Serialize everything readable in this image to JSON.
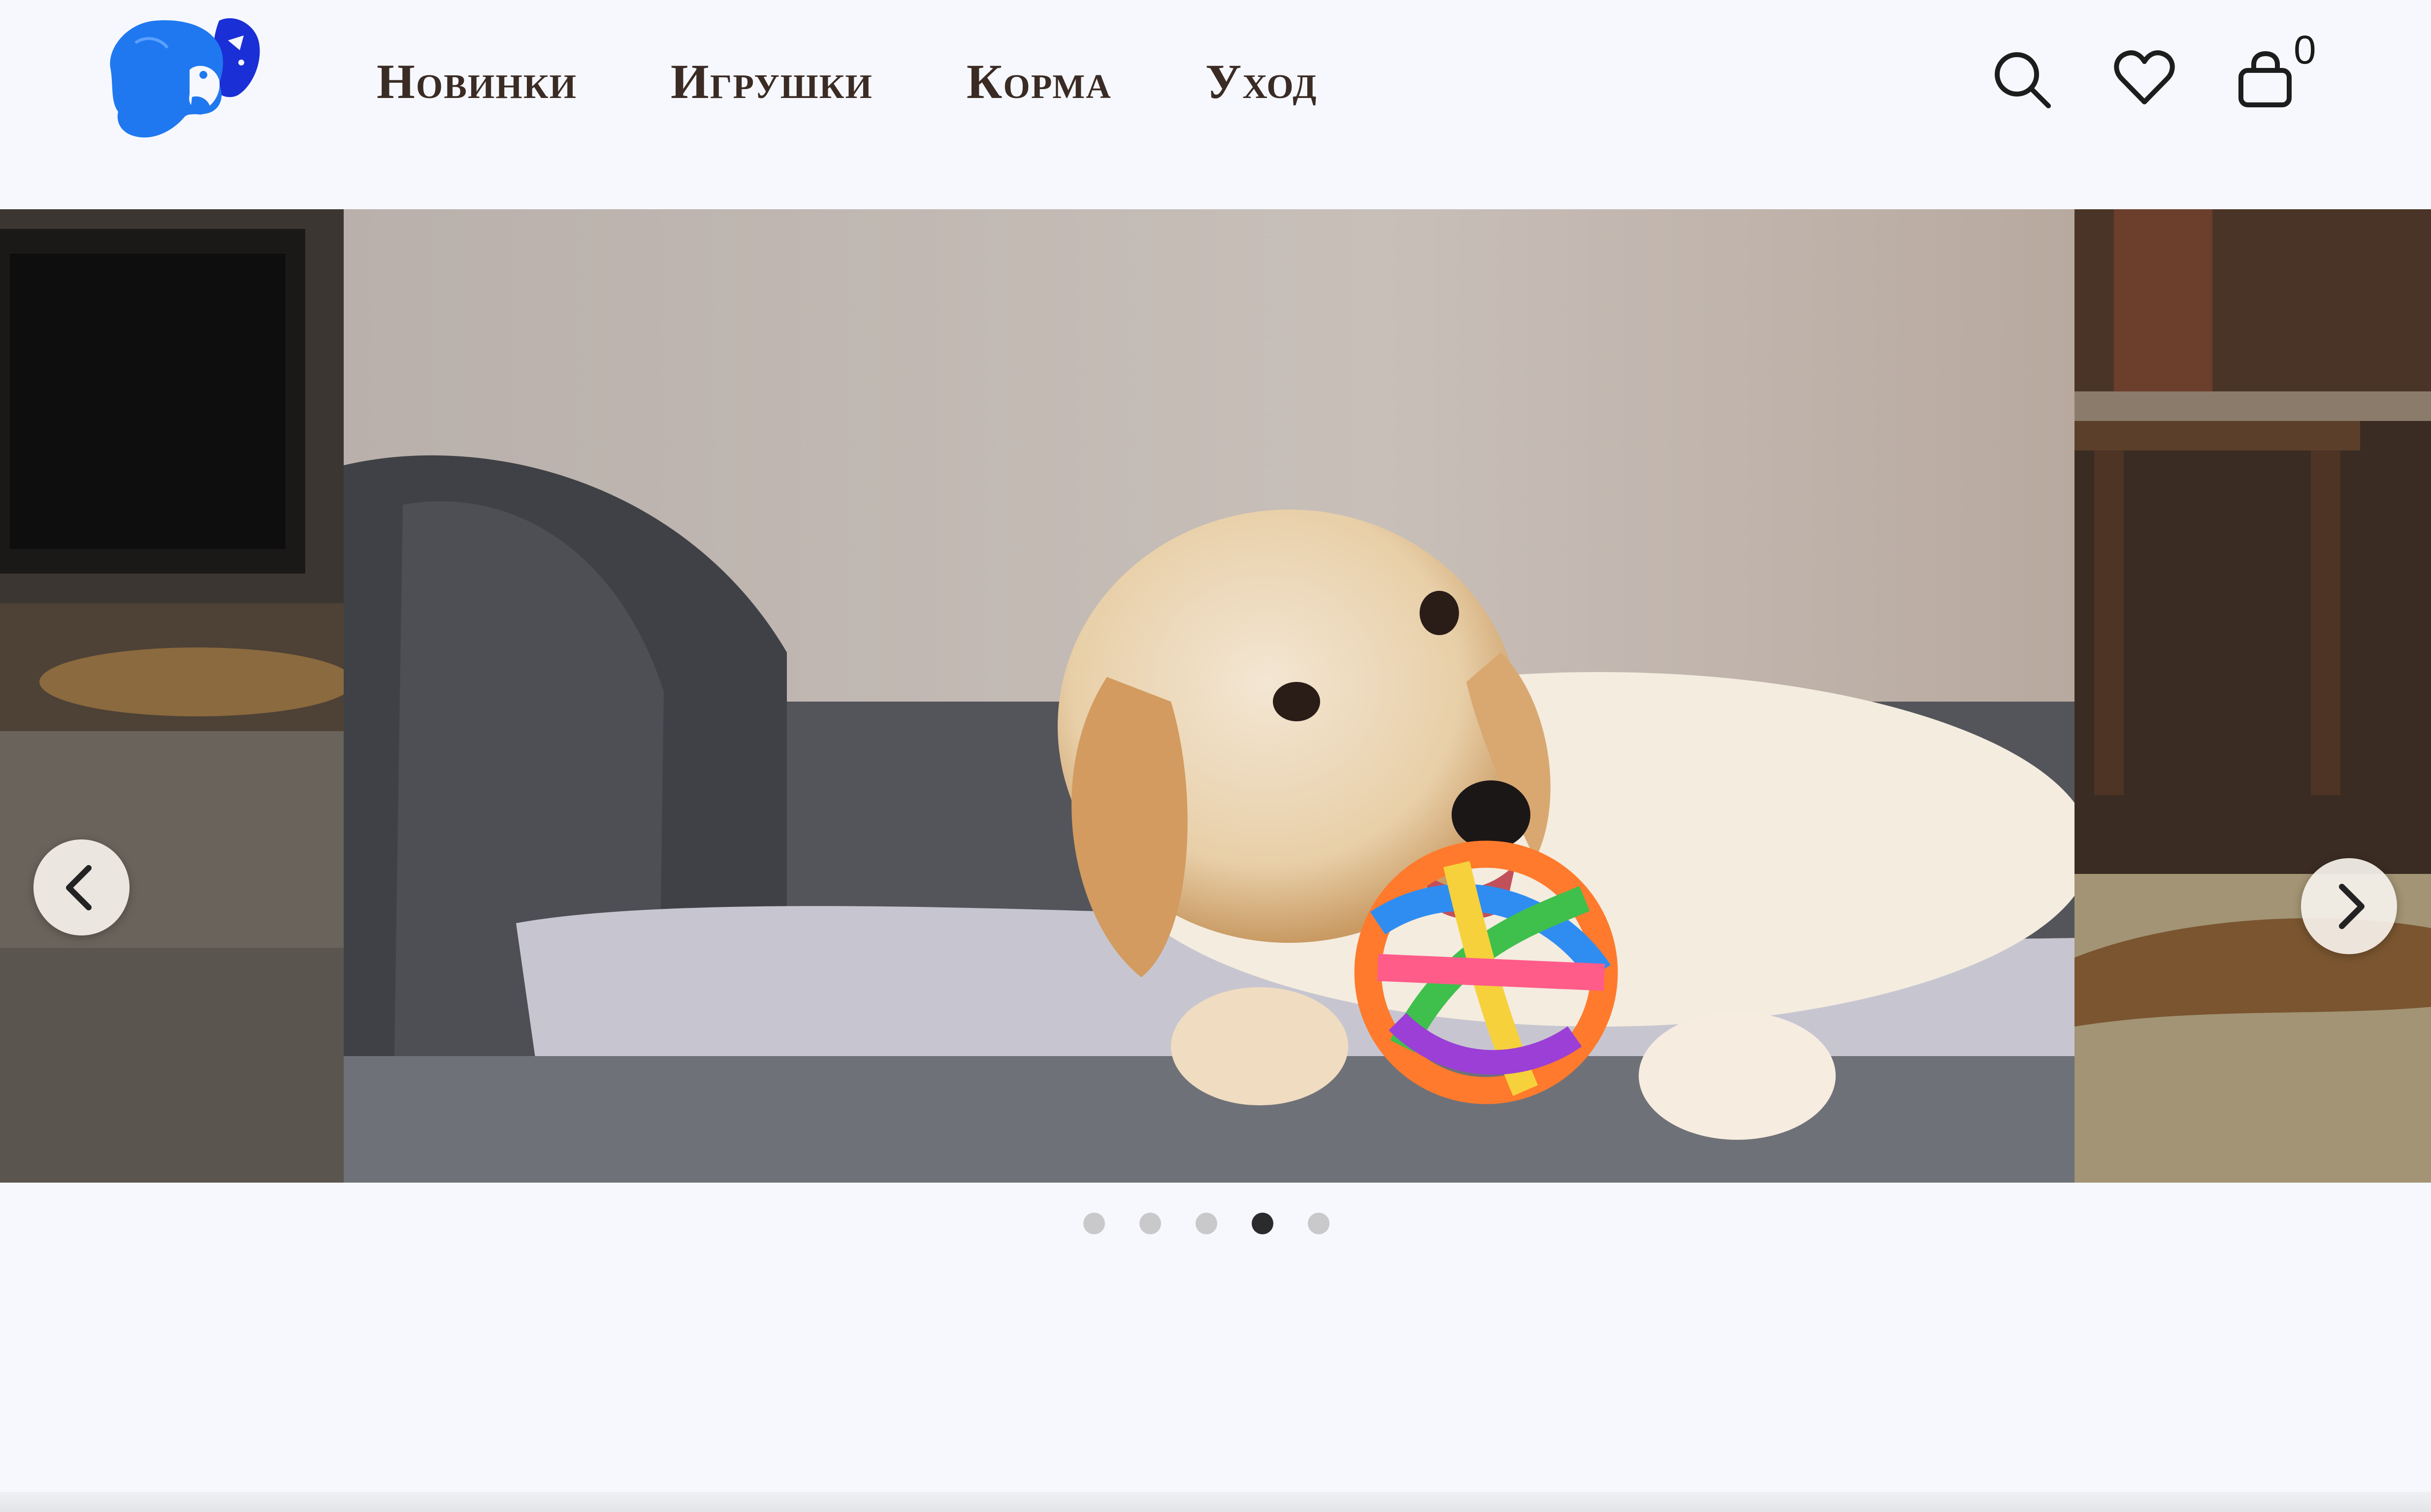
{
  "brand": {
    "logo_icon": "dog-head-logo-icon",
    "colors": {
      "primary": "#1f78f0",
      "secondary": "#1a2fd6"
    }
  },
  "nav": {
    "items": [
      {
        "label": "Новинки"
      },
      {
        "label": "Игрушки"
      },
      {
        "label": "Корма"
      },
      {
        "label": "Уход"
      }
    ]
  },
  "header_actions": {
    "search_icon": "search-icon",
    "favorites_icon": "heart-icon",
    "cart_icon": "shopping-bag-icon",
    "cart_count": "0"
  },
  "slider": {
    "prev_icon": "chevron-left-icon",
    "next_icon": "chevron-right-icon",
    "slide_count": 5,
    "active_slide": 4
  }
}
